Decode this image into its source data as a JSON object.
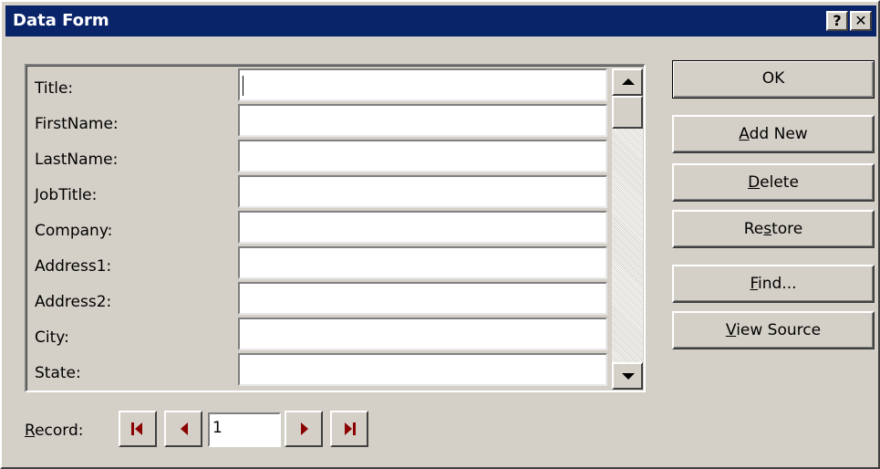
{
  "window": {
    "title": "Data Form",
    "help_label": "?",
    "close_label": "✕"
  },
  "fields": [
    {
      "label": "Title:",
      "value": ""
    },
    {
      "label": "FirstName:",
      "value": ""
    },
    {
      "label": "LastName:",
      "value": ""
    },
    {
      "label": "JobTitle:",
      "value": ""
    },
    {
      "label": "Company:",
      "value": ""
    },
    {
      "label": "Address1:",
      "value": ""
    },
    {
      "label": "Address2:",
      "value": ""
    },
    {
      "label": "City:",
      "value": ""
    },
    {
      "label": "State:",
      "value": ""
    }
  ],
  "buttons": {
    "ok": {
      "label": "OK"
    },
    "add_new": {
      "pre": "",
      "accel": "A",
      "post": "dd New"
    },
    "delete": {
      "pre": "",
      "accel": "D",
      "post": "elete"
    },
    "restore": {
      "pre": "Re",
      "accel": "s",
      "post": "tore"
    },
    "find": {
      "pre": "",
      "accel": "F",
      "post": "ind..."
    },
    "view_source": {
      "pre": "",
      "accel": "V",
      "post": "iew Source"
    }
  },
  "record": {
    "label_accel": "R",
    "label_rest": "ecord:",
    "value": "1"
  },
  "colors": {
    "titlebar": "#0a246a",
    "face": "#d4d0c8",
    "nav_arrow": "#8b0000"
  }
}
